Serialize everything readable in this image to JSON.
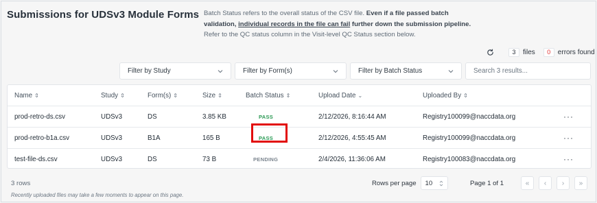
{
  "header": {
    "title": "Submissions for UDSv3 Module Forms",
    "note_line1_plain": "Batch Status refers to the overall status of the CSV file. ",
    "note_line1_bold": "Even if a file passed batch",
    "note_line2_bold_start": "validation, ",
    "note_line2_underlined": "individual records in the file can fail",
    "note_line2_bold_end": " further down the submission pipeline.",
    "note_line3": "Refer to the QC status column in the Visit-level QC Status section below."
  },
  "counts": {
    "files_count": "3",
    "files_label": "files",
    "errors_count": "0",
    "errors_label": "errors found",
    "refresh_icon": "refresh-icon"
  },
  "filters": {
    "study": "Filter by Study",
    "forms": "Filter by Form(s)",
    "batch_status": "Filter by Batch Status",
    "search_placeholder": "Search 3 results..."
  },
  "table": {
    "columns": {
      "name": "Name",
      "study": "Study",
      "forms": "Form(s)",
      "size": "Size",
      "batch_status": "Batch Status",
      "upload_date": "Upload Date",
      "uploaded_by": "Uploaded By"
    },
    "rows": [
      {
        "name": "prod-retro-ds.csv",
        "study": "UDSv3",
        "forms": "DS",
        "size": "3.85 KB",
        "status": "PASS",
        "upload_date": "2/12/2026, 8:16:44 AM",
        "uploaded_by": "Registry100099@naccdata.org",
        "actions": "···"
      },
      {
        "name": "prod-retro-b1a.csv",
        "study": "UDSv3",
        "forms": "B1A",
        "size": "165 B",
        "status": "PASS",
        "upload_date": "2/12/2026, 4:55:45 AM",
        "uploaded_by": "Registry100099@naccdata.org",
        "actions": "···"
      },
      {
        "name": "test-file-ds.csv",
        "study": "UDSv3",
        "forms": "DS",
        "size": "73 B",
        "status": "PENDING",
        "upload_date": "2/4/2026, 11:36:06 AM",
        "uploaded_by": "Registry100083@naccdata.org",
        "actions": "···"
      }
    ]
  },
  "footer": {
    "row_count": "3 rows",
    "rows_per_page_label": "Rows per page",
    "rows_per_page_value": "10",
    "page_info": "Page 1 of 1",
    "hint": "Recently uploaded files may take a few moments to appear on this page."
  },
  "colors": {
    "pass": "#2d9a55",
    "pending": "#7a848e",
    "error_count": "#e03131",
    "highlight": "#e20a0a"
  }
}
